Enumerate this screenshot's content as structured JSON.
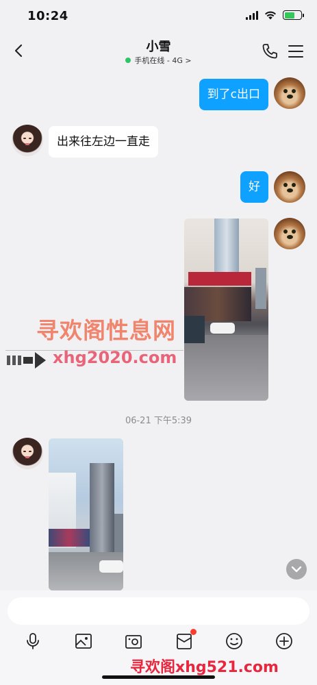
{
  "status_bar": {
    "time": "10:24"
  },
  "header": {
    "contact_name": "小雪",
    "status_text": "手机在线 - 4G",
    "status_chevron": ">"
  },
  "messages": [
    {
      "type": "text",
      "direction": "out",
      "text": "到了c出口"
    },
    {
      "type": "text",
      "direction": "in",
      "text": "出来往左边一直走"
    },
    {
      "type": "text",
      "direction": "out",
      "text": "好"
    },
    {
      "type": "image",
      "direction": "out",
      "description": "street photo"
    },
    {
      "type": "timestamp",
      "text": "06-21 下午5:39"
    },
    {
      "type": "image",
      "direction": "in",
      "description": "street photo"
    }
  ],
  "watermarks": {
    "main": "寻欢阁性息网",
    "url": "xhg2020.com",
    "bottom": "寻欢阁xhg521.com"
  },
  "input": {
    "placeholder": ""
  },
  "toolbar": {
    "icons": [
      "microphone-icon",
      "image-icon",
      "camera-icon",
      "red-packet-icon",
      "emoji-icon",
      "plus-icon"
    ],
    "red_packet_badge": true
  },
  "colors": {
    "bubble_out": "#0fa1ff",
    "bubble_in": "#ffffff",
    "background": "#f1f1f3",
    "online": "#2dc56a",
    "badge": "#fa3d2f"
  }
}
